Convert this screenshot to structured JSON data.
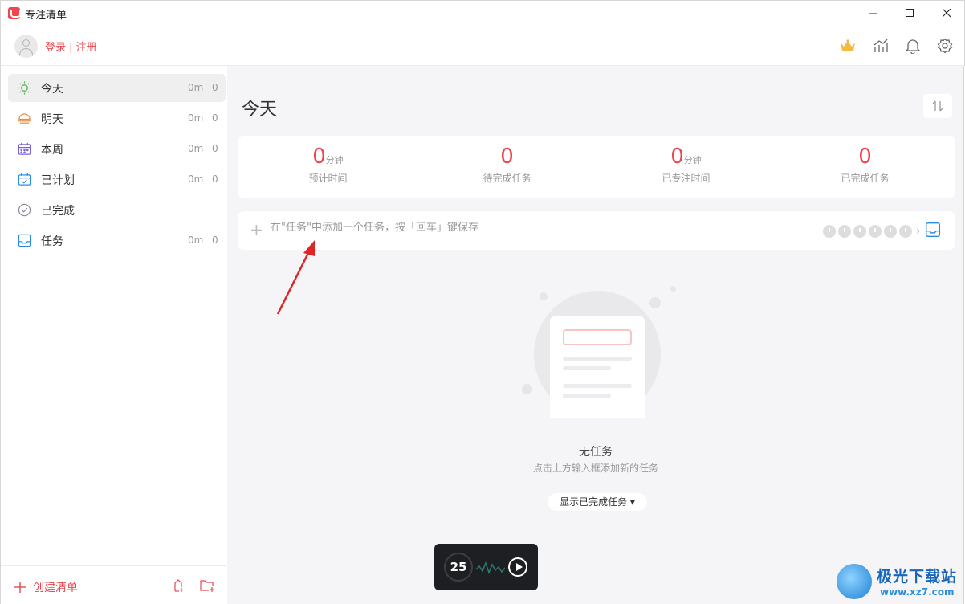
{
  "window": {
    "title": "专注清单",
    "min_label": "—",
    "max_label": "☐",
    "close_label": "✕"
  },
  "header": {
    "login_text": "登录 | 注册"
  },
  "sidebar": {
    "items": [
      {
        "label": "今天",
        "time": "0m",
        "count": "0",
        "icon": "sun-icon"
      },
      {
        "label": "明天",
        "time": "0m",
        "count": "0",
        "icon": "sunset-icon"
      },
      {
        "label": "本周",
        "time": "0m",
        "count": "0",
        "icon": "calendar-week-icon"
      },
      {
        "label": "已计划",
        "time": "0m",
        "count": "0",
        "icon": "calendar-check-icon"
      },
      {
        "label": "已完成",
        "icon": "check-circle-icon"
      },
      {
        "label": "任务",
        "time": "0m",
        "count": "0",
        "icon": "inbox-icon"
      }
    ],
    "create_list_label": "创建清单"
  },
  "main": {
    "title": "今天",
    "stats": [
      {
        "value": "0",
        "unit": "分钟",
        "label": "预计时间"
      },
      {
        "value": "0",
        "unit": "",
        "label": "待完成任务"
      },
      {
        "value": "0",
        "unit": "分钟",
        "label": "已专注时间"
      },
      {
        "value": "0",
        "unit": "",
        "label": "已完成任务"
      }
    ],
    "add_task": {
      "placeholder": "在\"任务\"中添加一个任务，按「回车」键保存",
      "value": "",
      "pomodoro_count": 6
    },
    "empty": {
      "title": "无任务",
      "subtitle": "点击上方输入框添加新的任务",
      "show_completed_label": "显示已完成任务 ▾"
    }
  },
  "timer": {
    "minutes": "25"
  },
  "watermark": {
    "name": "极光下载站",
    "url": "www.xz7.com"
  },
  "colors": {
    "accent": "#f0454f",
    "sidebar_active": "#efefef",
    "main_bg": "#f5f5f7"
  }
}
